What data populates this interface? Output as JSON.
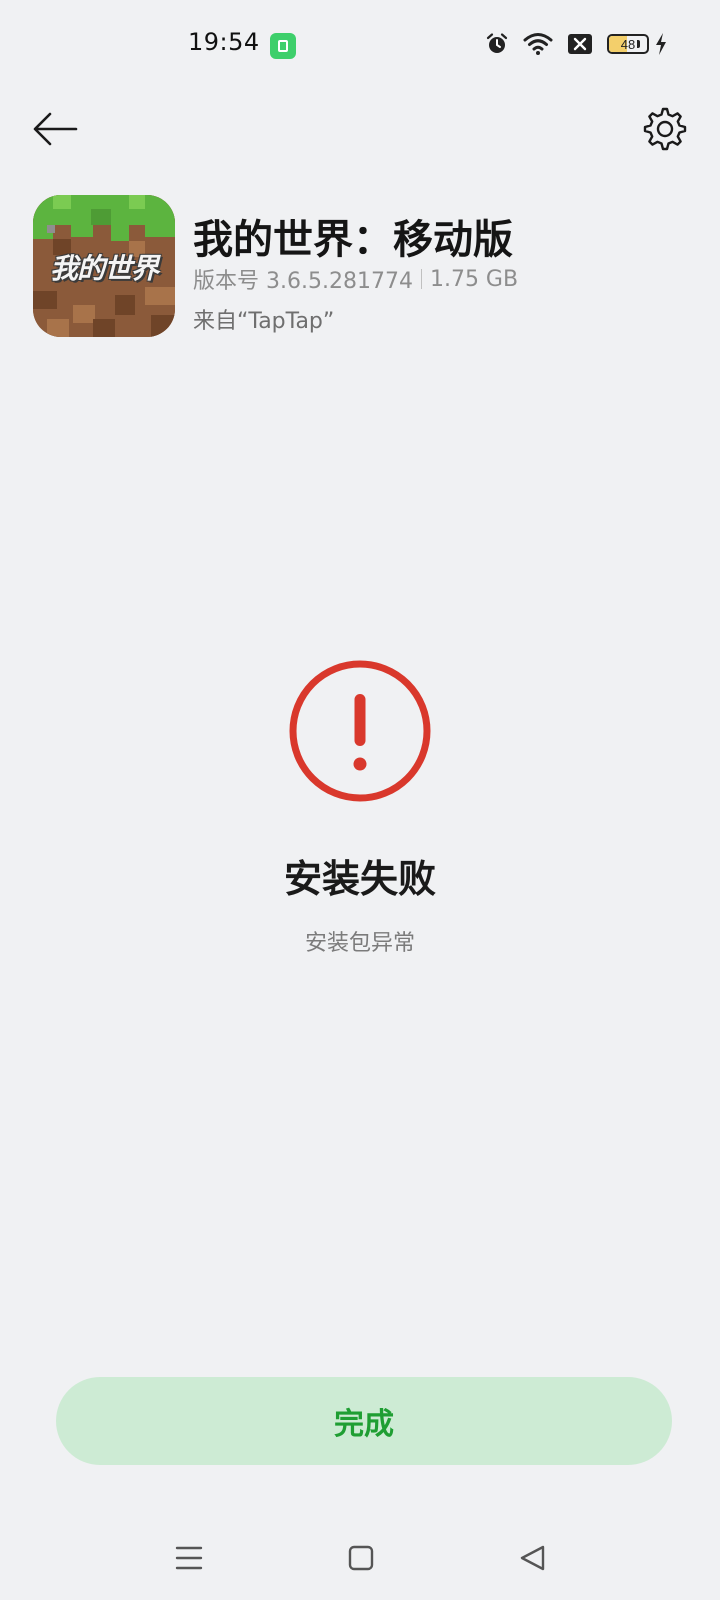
{
  "status_bar": {
    "time": "19:54",
    "battery_level": 48,
    "battery_label": "48",
    "icons": [
      "app-notification-icon",
      "alarm-icon",
      "wifi-icon",
      "sim-blocked-icon",
      "battery-icon",
      "charging-icon"
    ]
  },
  "top_bar": {
    "back_icon": "arrow-left-icon",
    "settings_icon": "gear-icon"
  },
  "app": {
    "name": "我的世界：移动版",
    "version": "版本号 3.6.5.281774",
    "size": "1.75 GB",
    "source": "来自“TapTap”",
    "icon_label": "我的世界"
  },
  "result": {
    "title": "安装失败",
    "subtitle": "安装包异常",
    "icon": "error-exclamation-icon",
    "accent_color": "#d9382c"
  },
  "actions": {
    "done_label": "完成",
    "done_color": "#1f9e33",
    "done_bg": "#cdebd4"
  },
  "nav": {
    "menu_icon": "menu-icon",
    "home_icon": "home-square-icon",
    "back_icon": "back-triangle-icon"
  }
}
